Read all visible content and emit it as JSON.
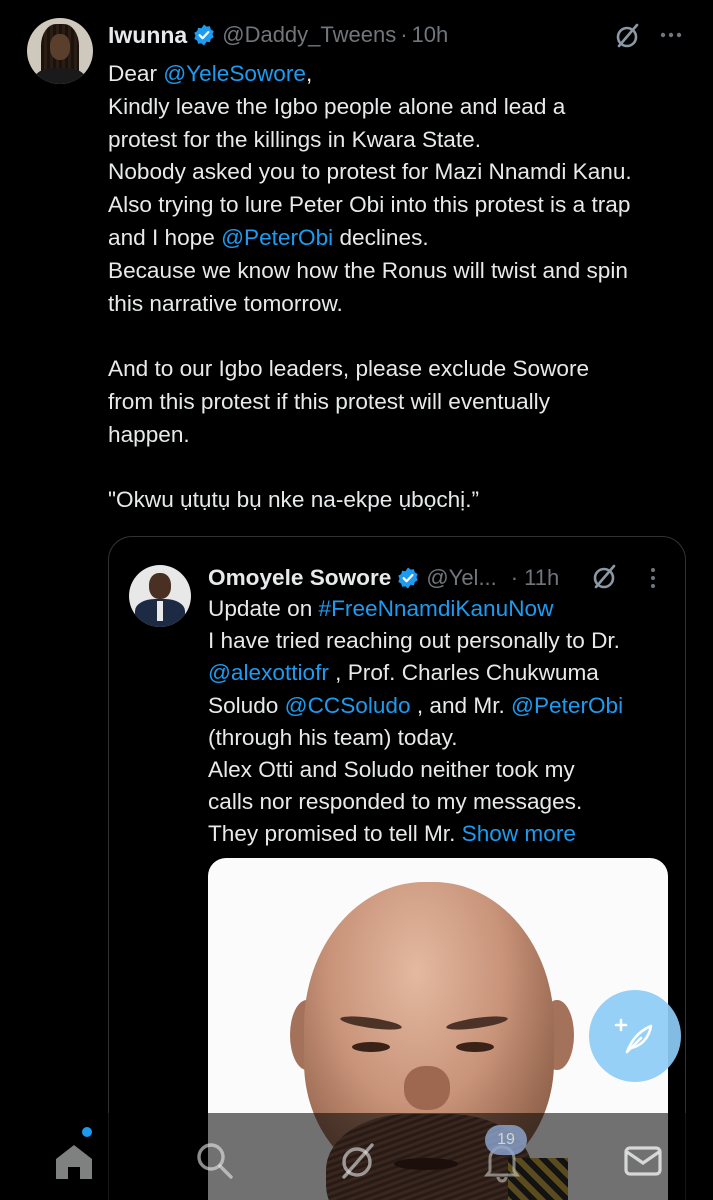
{
  "tweet": {
    "author_name": "Iwunna",
    "author_handle": "@Daddy_Tweens",
    "separator": "·",
    "time": "10h",
    "icons": {
      "verified": "verified-badge-icon",
      "grok": "grok-icon",
      "more": "more-options-icon"
    },
    "lines": [
      {
        "parts": [
          {
            "t": "Dear "
          },
          {
            "t": "@YeleSowore",
            "m": true
          },
          {
            "t": ","
          }
        ]
      },
      {
        "parts": [
          {
            "t": "Kindly leave the Igbo people alone and lead a"
          }
        ]
      },
      {
        "parts": [
          {
            "t": "protest for the killings in Kwara State."
          }
        ]
      },
      {
        "parts": [
          {
            "t": "Nobody asked you to protest for Mazi Nnamdi Kanu."
          }
        ]
      },
      {
        "parts": [
          {
            "t": "Also trying to lure Peter Obi into this protest is a trap"
          }
        ]
      },
      {
        "parts": [
          {
            "t": "and I hope "
          },
          {
            "t": "@PeterObi",
            "m": true
          },
          {
            "t": " declines."
          }
        ]
      },
      {
        "parts": [
          {
            "t": "Because we know how the Ronus will twist and spin"
          }
        ]
      },
      {
        "parts": [
          {
            "t": "this narrative tomorrow."
          }
        ]
      },
      {
        "gap": true
      },
      {
        "parts": [
          {
            "t": "And to our Igbo leaders, please exclude Sowore"
          }
        ]
      },
      {
        "parts": [
          {
            "t": "from this protest if this protest will eventually"
          }
        ]
      },
      {
        "parts": [
          {
            "t": "happen."
          }
        ]
      },
      {
        "gap": true
      },
      {
        "parts": [
          {
            "t": "\"Okwu ụtụtụ bụ nke na-ekpe ụbọchị.”"
          }
        ]
      }
    ]
  },
  "quoted_tweet": {
    "author_name": "Omoyele Sowore",
    "author_handle": "@Yel...",
    "separator": "·",
    "time": "11h",
    "lines": [
      {
        "parts": [
          {
            "t": "Update on "
          },
          {
            "t": "#FreeNnamdiKanuNow",
            "m": true
          }
        ]
      },
      {
        "parts": [
          {
            "t": "I have tried reaching out personally to Dr."
          }
        ]
      },
      {
        "parts": [
          {
            "t": "@alexottiofr",
            "m": true
          },
          {
            "t": " , Prof. Charles Chukwuma"
          }
        ]
      },
      {
        "parts": [
          {
            "t": "Soludo "
          },
          {
            "t": "@CCSoludo",
            "m": true
          },
          {
            "t": " , and Mr. "
          },
          {
            "t": "@PeterObi",
            "m": true
          }
        ]
      },
      {
        "parts": [
          {
            "t": "(through his team) today."
          }
        ]
      },
      {
        "parts": [
          {
            "t": "Alex Otti and Soludo neither took my"
          }
        ]
      },
      {
        "parts": [
          {
            "t": "calls nor responded to my messages."
          }
        ]
      },
      {
        "parts": [
          {
            "t": "They promised to tell Mr. "
          },
          {
            "t": "Show more",
            "m": true
          }
        ]
      }
    ],
    "image": "photo-bald-bearded-man"
  },
  "compose_button": {
    "icon": "compose-post-icon"
  },
  "bottom_nav": {
    "items": [
      {
        "name": "home",
        "icon": "home-icon"
      },
      {
        "name": "search",
        "icon": "search-icon"
      },
      {
        "name": "grok",
        "icon": "grok-icon"
      },
      {
        "name": "notifications",
        "icon": "bell-icon"
      },
      {
        "name": "messages",
        "icon": "mail-icon"
      }
    ],
    "notifications_badge": "19"
  },
  "colors": {
    "background": "#000000",
    "text": "#e7e9ea",
    "muted": "#71767b",
    "accent": "#1d9bf0"
  }
}
